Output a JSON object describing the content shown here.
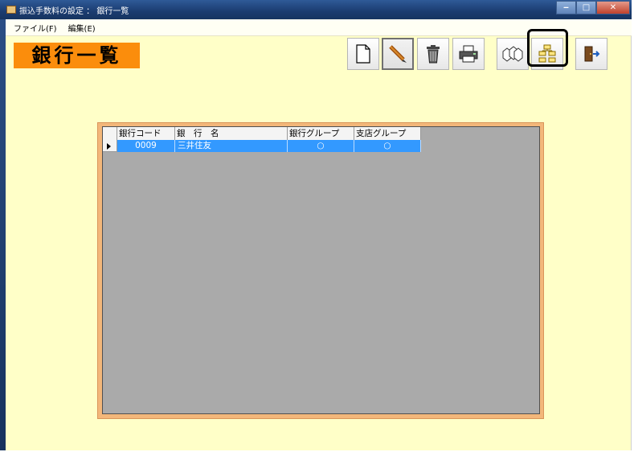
{
  "window": {
    "title": "振込手数料の設定 ： 銀行一覧",
    "minimize_label": "‒",
    "maximize_label": "□",
    "close_label": "✕"
  },
  "menu": {
    "items": [
      "ファイル(F)",
      "編集(E)"
    ]
  },
  "page": {
    "title": "銀行一覧"
  },
  "toolbar": {
    "buttons": [
      {
        "icon": "new-document-icon"
      },
      {
        "icon": "edit-pencil-icon",
        "state": "pressed"
      },
      {
        "icon": "trash-can-icon"
      },
      {
        "icon": "printer-icon"
      },
      {
        "icon": "bank-group-icon"
      },
      {
        "icon": "branch-group-icon",
        "state": "highlighted"
      },
      {
        "icon": "exit-door-icon"
      }
    ]
  },
  "grid": {
    "columns": [
      "銀行コード",
      "銀　行　名",
      "銀行グループ",
      "支店グループ"
    ],
    "rows": [
      {
        "code": "0009",
        "name": "三井住友",
        "bank_group": "○",
        "branch_group": "○",
        "selected": true
      }
    ]
  },
  "colors": {
    "background": "#ffffc8",
    "title_badge": "#fb8d0c",
    "grid_frame": "#f3b77a",
    "grid_body": "#aaaaaa",
    "selection": "#3399ff"
  }
}
